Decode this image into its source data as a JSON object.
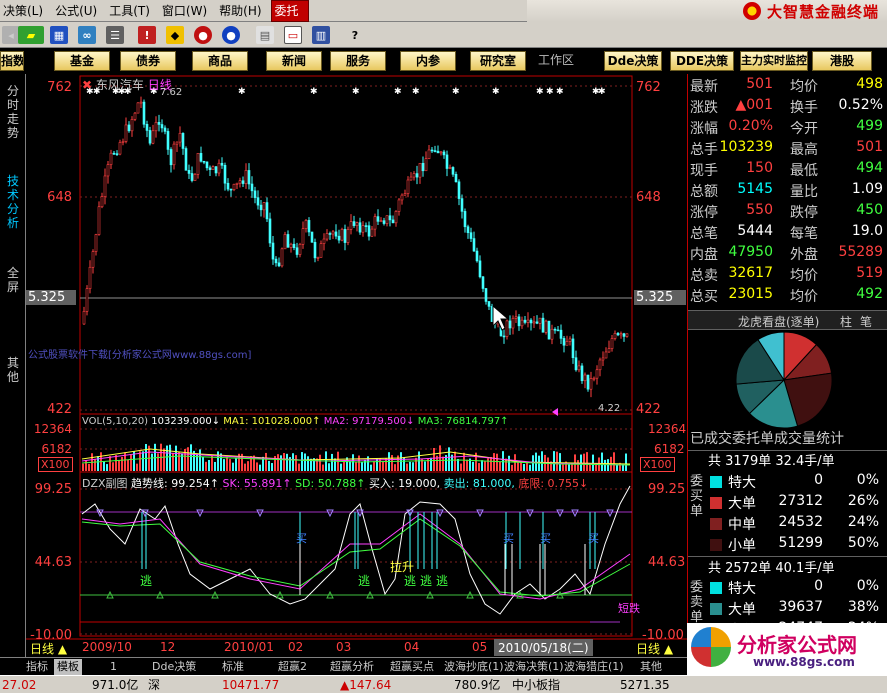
{
  "menu": {
    "items": [
      {
        "label": "决策(L)"
      },
      {
        "label": "公式(U)"
      },
      {
        "label": "工具(T)"
      },
      {
        "label": "窗口(W)"
      },
      {
        "label": "帮助(H)"
      },
      {
        "label": "委托",
        "active": true
      }
    ],
    "brand": "大智慧金融终端"
  },
  "nav": {
    "buttons": [
      "指数",
      "基金",
      "债券",
      "商品",
      "新闻",
      "服务",
      "内参",
      "研究室"
    ],
    "workspace": "工作区",
    "right_buttons": [
      "Dde决策",
      "DDE决策",
      "主力实时监控",
      "港股"
    ]
  },
  "left_tabs": [
    {
      "label": "分时走势",
      "active": false
    },
    {
      "label": "技术分析",
      "active": true
    },
    {
      "label": "全屏",
      "active": false
    },
    {
      "label": "其他",
      "active": false
    }
  ],
  "price_chart": {
    "stock_name": "东风汽车",
    "period": "日线",
    "y_labels": [
      "762",
      "648",
      "5.325",
      "422"
    ],
    "high_marker": "7.62",
    "low_marker": "4.22",
    "watermark": "公式股票软件下载[分析家公式网www.88gs.com]"
  },
  "volume_chart": {
    "header": {
      "name": "VOL(5,10,20)",
      "vol": "103239.000↓",
      "ma1": "MA1: 101028.000↑",
      "ma2": "MA2: 97179.500↓",
      "ma3": "MA3: 76814.797↑"
    },
    "y_labels": [
      "12364",
      "6182",
      "X100"
    ]
  },
  "indicator_chart": {
    "header": {
      "name": "DZX副图",
      "trend": "趋势线: 99.254↑",
      "sk": "SK: 55.891↑",
      "sd": "SD: 50.788↑",
      "buy": "买入: 19.000,",
      "sell": "卖出: 81.000,",
      "bottom": "底限: 0.755↓"
    },
    "y_labels": [
      "99.25",
      "44.63",
      "-10.00"
    ],
    "annotations": {
      "escape": "逃",
      "pull_up": "拉升",
      "buy": "买",
      "short_fall": "短跌"
    }
  },
  "x_axis": {
    "labels": [
      "2009/10",
      "12",
      "2010/01",
      "02",
      "03",
      "04",
      "05"
    ],
    "cursor_date": "2010/05/18(二)",
    "period_label": "日线"
  },
  "quote": {
    "rows": [
      {
        "l1": "最新",
        "v1": "501",
        "c1": "red",
        "l2": "均价",
        "v2": "498",
        "c2": "yellow"
      },
      {
        "l1": "涨跌",
        "v1": "▲001",
        "c1": "red",
        "l2": "换手",
        "v2": "0.52%",
        "c2": "white"
      },
      {
        "l1": "涨幅",
        "v1": "0.20%",
        "c1": "red",
        "l2": "今开",
        "v2": "499",
        "c2": "green"
      },
      {
        "l1": "总手",
        "v1": "103239",
        "c1": "yellow",
        "l2": "最高",
        "v2": "501",
        "c2": "red"
      },
      {
        "l1": "现手",
        "v1": "150",
        "c1": "red",
        "l2": "最低",
        "v2": "494",
        "c2": "green"
      },
      {
        "l1": "总额",
        "v1": "5145",
        "c1": "cyan",
        "l2": "量比",
        "v2": "1.09",
        "c2": "white"
      },
      {
        "l1": "涨停",
        "v1": "550",
        "c1": "red",
        "l2": "跌停",
        "v2": "450",
        "c2": "green"
      },
      {
        "l1": "总笔",
        "v1": "5444",
        "c1": "white",
        "l2": "每笔",
        "v2": "19.0",
        "c2": "white"
      },
      {
        "l1": "内盘",
        "v1": "47950",
        "c1": "green",
        "l2": "外盘",
        "v2": "55289",
        "c2": "red"
      },
      {
        "l1": "总卖",
        "v1": "32617",
        "c1": "yellow",
        "l2": "均价",
        "v2": "519",
        "c2": "red"
      },
      {
        "l1": "总买",
        "v1": "23015",
        "c1": "yellow",
        "l2": "均价",
        "v2": "492",
        "c2": "green"
      }
    ]
  },
  "dragon": {
    "title": "龙虎看盘(逐单)",
    "tab1": "柱",
    "tab2": "笔",
    "stat_title": "已成交委托单成交量统计"
  },
  "buy_orders": {
    "summary": "共 3179单 32.4手/单",
    "label": "委买单",
    "rows": [
      {
        "name": "特大",
        "count": "0",
        "pct": "0%",
        "color": "#00e0e0"
      },
      {
        "name": "大单",
        "count": "27312",
        "pct": "26%",
        "color": "#d03030"
      },
      {
        "name": "中单",
        "count": "24532",
        "pct": "24%",
        "color": "#802020"
      },
      {
        "name": "小单",
        "count": "51299",
        "pct": "50%",
        "color": "#401010"
      }
    ]
  },
  "sell_orders": {
    "summary": "共 2572单 40.1手/单",
    "label": "委卖单",
    "rows": [
      {
        "name": "特大",
        "count": "0",
        "pct": "0%",
        "color": "#00e0e0"
      },
      {
        "name": "大单",
        "count": "39637",
        "pct": "38%",
        "color": "#2a8f8f"
      },
      {
        "name": "中单",
        "count": "24747",
        "pct": "24%",
        "color": "#206060"
      }
    ]
  },
  "pie": {
    "slices": [
      {
        "value": 26,
        "color": "#d03030"
      },
      {
        "value": 24,
        "color": "#802020"
      },
      {
        "value": 50,
        "color": "#401010"
      },
      {
        "value": 38,
        "color": "#2a8f8f"
      },
      {
        "value": 24,
        "color": "#206060"
      },
      {
        "value": 38,
        "color": "#1a4a4a"
      },
      {
        "value": 20,
        "color": "#40c0d0"
      }
    ]
  },
  "bottom_tabs": [
    "指标",
    "模板",
    "1",
    "Dde决策",
    "标准",
    "超赢2",
    "超赢分析",
    "超赢买点",
    "波海抄底(1)",
    "波海决策(1)",
    "波海猎庄(1)",
    "其他"
  ],
  "status": {
    "s1": "27.02",
    "s2": "971.0亿",
    "s3": "深",
    "s4": "10471.77",
    "s5": "▲147.64",
    "s6": "780.9亿",
    "s7": "中小板指",
    "s8": "5271.35"
  },
  "watermark": {
    "site": "分析家公式网",
    "url": "www.88gs.com"
  }
}
